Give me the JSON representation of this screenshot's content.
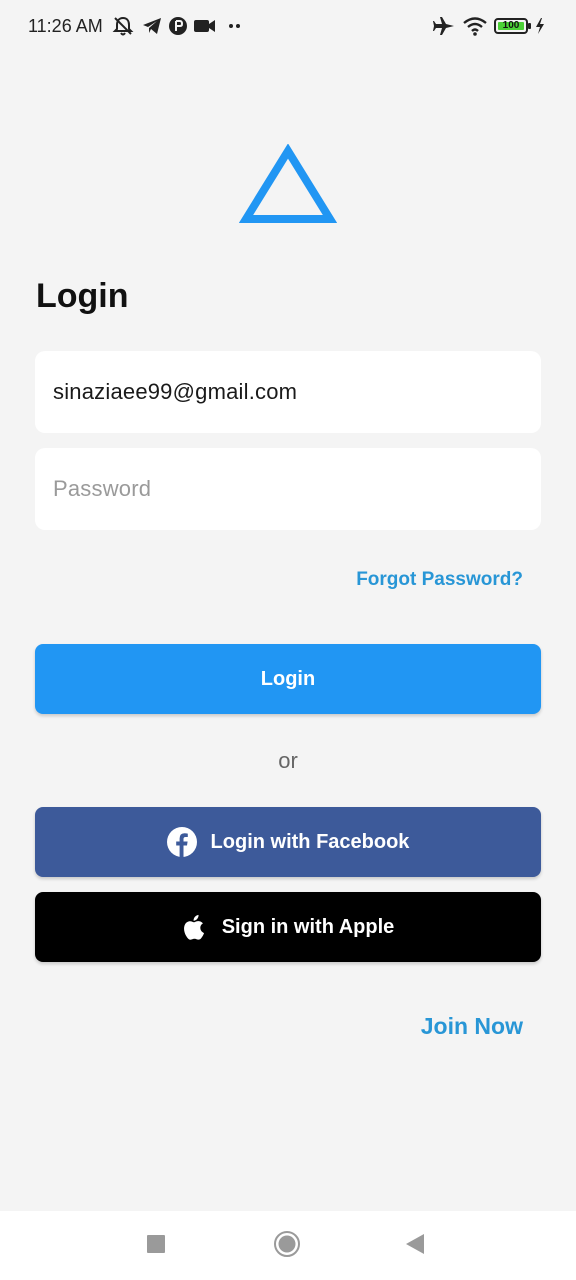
{
  "status_bar": {
    "time": "11:26 AM",
    "battery": "100",
    "icons": [
      "mute-icon",
      "telegram-icon",
      "app-icon",
      "video-icon",
      "more-dots-icon",
      "airplane-icon",
      "wifi-icon",
      "battery-icon",
      "charging-icon"
    ]
  },
  "logo": {
    "icon": "triangle-logo-icon",
    "color": "#2196f3"
  },
  "page": {
    "title": "Login"
  },
  "form": {
    "email_value": "sinaziaee99@gmail.com",
    "password_placeholder": "Password",
    "forgot_label": "Forgot Password?",
    "login_label": "Login",
    "or_label": "or",
    "facebook_label": "Login with Facebook",
    "apple_label": "Sign in with Apple",
    "join_label": "Join Now"
  },
  "colors": {
    "primary": "#2196f3",
    "link": "#2896d6",
    "facebook": "#3d5a9a",
    "apple": "#000000",
    "background": "#f4f4f4"
  },
  "nav_bar": {
    "icons": [
      "recents-square-icon",
      "home-circle-icon",
      "back-triangle-icon"
    ]
  }
}
